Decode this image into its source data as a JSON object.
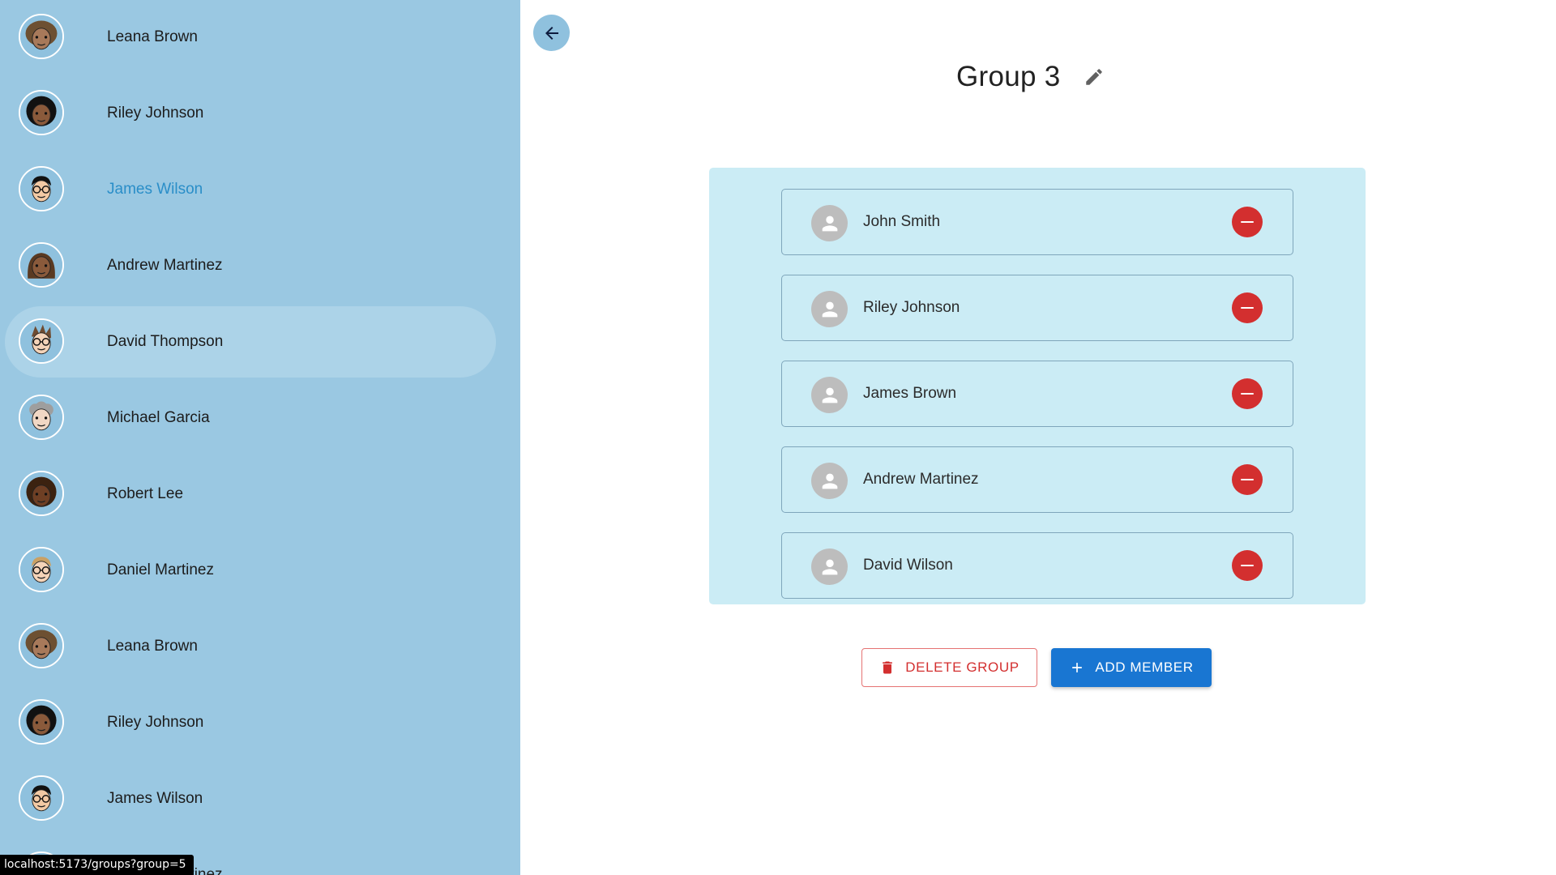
{
  "sidebar": {
    "users": [
      {
        "name": "Leana Brown",
        "avatar": "leana-avatar",
        "state": ""
      },
      {
        "name": "Riley Johnson",
        "avatar": "riley-avatar",
        "state": ""
      },
      {
        "name": "James Wilson",
        "avatar": "james-avatar",
        "state": "active"
      },
      {
        "name": "Andrew Martinez",
        "avatar": "andrew-avatar",
        "state": ""
      },
      {
        "name": "David Thompson",
        "avatar": "david-avatar",
        "state": "hovered"
      },
      {
        "name": "Michael Garcia",
        "avatar": "michael-avatar",
        "state": ""
      },
      {
        "name": "Robert Lee",
        "avatar": "robert-avatar",
        "state": ""
      },
      {
        "name": "Daniel Martinez",
        "avatar": "daniel-avatar",
        "state": ""
      },
      {
        "name": "Leana Brown",
        "avatar": "leana-avatar",
        "state": ""
      },
      {
        "name": "Riley Johnson",
        "avatar": "riley-avatar",
        "state": ""
      },
      {
        "name": "James Wilson",
        "avatar": "james-avatar",
        "state": ""
      },
      {
        "name": "Andrew Martinez",
        "avatar": "andrew-avatar",
        "state": ""
      }
    ]
  },
  "header": {
    "back_icon": "arrow-left-icon",
    "title": "Group 3",
    "edit_icon": "pencil-icon"
  },
  "members": [
    {
      "name": "John Smith"
    },
    {
      "name": "Riley Johnson"
    },
    {
      "name": "James Brown"
    },
    {
      "name": "Andrew Martinez"
    },
    {
      "name": "David Wilson"
    }
  ],
  "actions": {
    "delete_label": "DELETE GROUP",
    "add_label": "ADD MEMBER"
  },
  "status_bar": {
    "url": "localhost:5173/groups?group=5"
  },
  "colors": {
    "sidebar_bg": "#9ac8e2",
    "panel_bg": "#cbecf5",
    "active_text": "#2a8ec8",
    "remove_red": "#d32f2f",
    "primary_blue": "#1976d2"
  }
}
